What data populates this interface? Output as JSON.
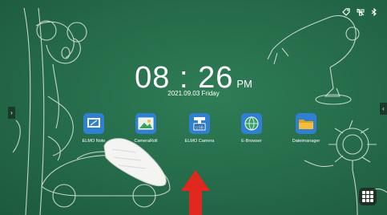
{
  "clock": {
    "time": "08 : 26",
    "ampm": "PM",
    "date": "2021.09.03  Friday"
  },
  "apps": [
    {
      "label": "ELMO Note",
      "icon": "note-icon"
    },
    {
      "label": "CameraRoll",
      "icon": "photo-icon"
    },
    {
      "label": "ELMO Camera",
      "icon": "usb-camera-icon"
    },
    {
      "label": "E-Browser",
      "icon": "globe-icon"
    },
    {
      "label": "Dateimanager",
      "icon": "folder-icon"
    }
  ],
  "status_icons": [
    "tag-icon",
    "network-off-icon",
    "bluetooth-icon"
  ],
  "colors": {
    "background": "#256a49",
    "app_tile": "#2f80d0",
    "arrow": "#e0281e"
  }
}
